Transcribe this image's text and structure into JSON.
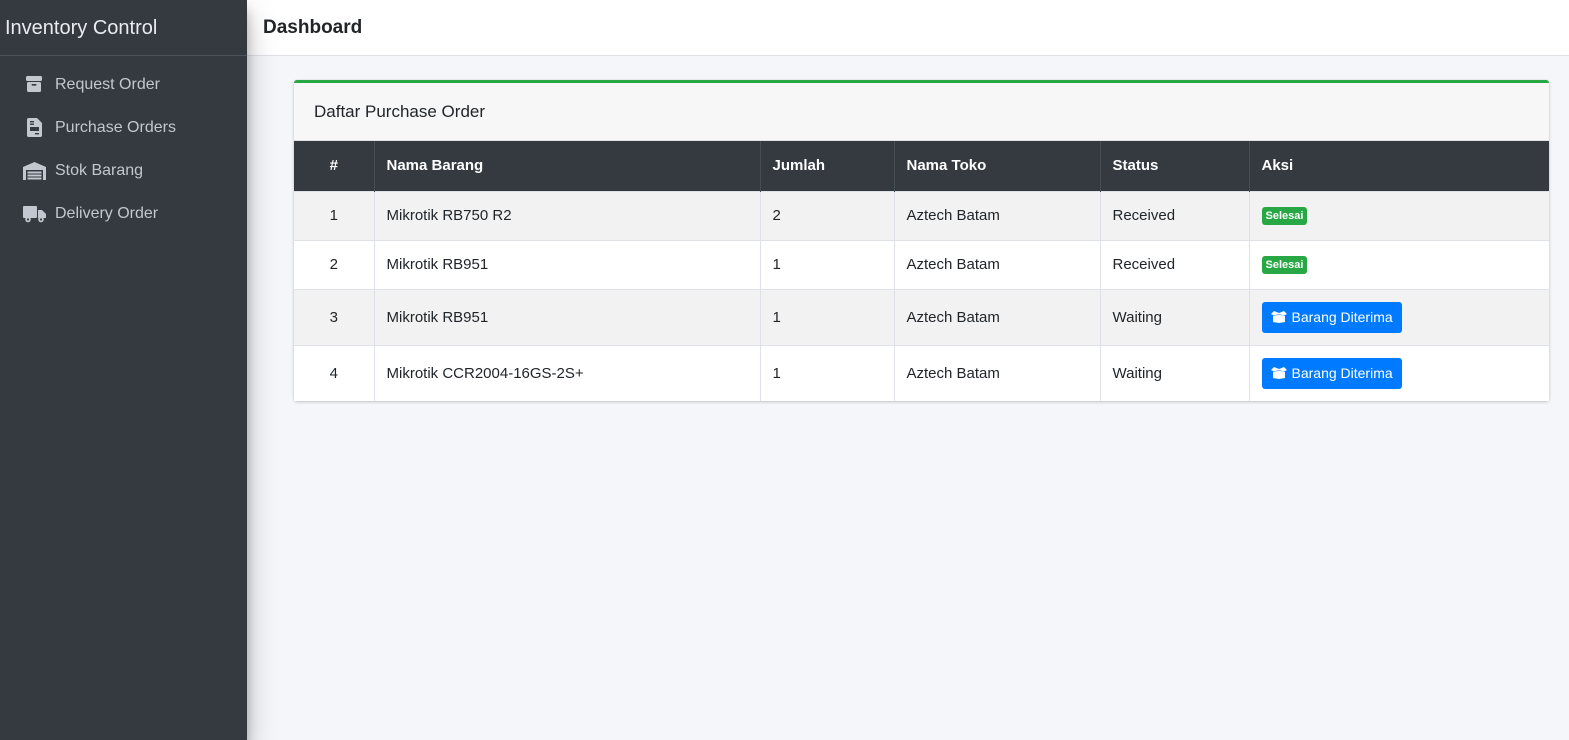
{
  "app": {
    "brand": "Inventory Control"
  },
  "sidebar": {
    "items": [
      {
        "label": "Request Order",
        "icon": "box-icon"
      },
      {
        "label": "Purchase Orders",
        "icon": "file-invoice-icon"
      },
      {
        "label": "Stok Barang",
        "icon": "warehouse-icon"
      },
      {
        "label": "Delivery Order",
        "icon": "truck-icon"
      }
    ]
  },
  "header": {
    "title": "Dashboard"
  },
  "card": {
    "title": "Daftar Purchase Order",
    "columns": [
      "#",
      "Nama Barang",
      "Jumlah",
      "Nama Toko",
      "Status",
      "Aksi"
    ],
    "rows": [
      {
        "no": "1",
        "nama_barang": "Mikrotik RB750 R2",
        "jumlah": "2",
        "nama_toko": "Aztech Batam",
        "status": "Received",
        "aksi": "Selesai"
      },
      {
        "no": "2",
        "nama_barang": "Mikrotik RB951",
        "jumlah": "1",
        "nama_toko": "Aztech Batam",
        "status": "Received",
        "aksi": "Selesai"
      },
      {
        "no": "3",
        "nama_barang": "Mikrotik RB951",
        "jumlah": "1",
        "nama_toko": "Aztech Batam",
        "status": "Waiting",
        "aksi": "Barang Diterima"
      },
      {
        "no": "4",
        "nama_barang": "Mikrotik CCR2004-16GS-2S+",
        "jumlah": "1",
        "nama_toko": "Aztech Batam",
        "status": "Waiting",
        "aksi": "Barang Diterima"
      }
    ]
  },
  "colors": {
    "sidebar": "#343a40",
    "accent_success": "#28a745",
    "accent_primary": "#007bff",
    "table_head": "#343a40"
  }
}
